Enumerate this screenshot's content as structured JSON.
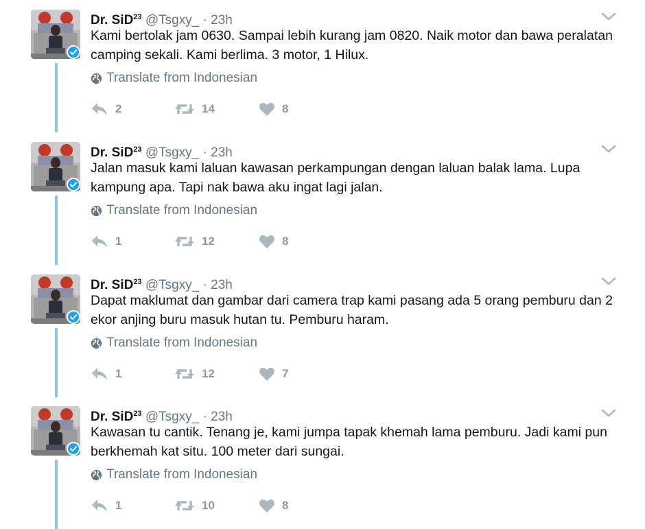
{
  "tweets": [
    {
      "name": "Dr. SiD",
      "name_sup": "23",
      "handle": "@Tsgxy_",
      "separator": "·",
      "time": "23h",
      "text": "Kami bertolak jam 0630. Sampai lebih kurang jam 0820. Naik motor dan bawa peralatan camping sekali. Kami berlima. 3 motor, 1 Hilux.",
      "translate": "Translate from Indonesian",
      "replies": "2",
      "retweets": "14",
      "likes": "8"
    },
    {
      "name": "Dr. SiD",
      "name_sup": "23",
      "handle": "@Tsgxy_",
      "separator": "·",
      "time": "23h",
      "text": "Jalan masuk kami laluan kawasan perkampungan dengan laluan balak lama. Lupa kampung apa. Tapi nak bawa aku ingat lagi jalan.",
      "translate": "Translate from Indonesian",
      "replies": "1",
      "retweets": "12",
      "likes": "8"
    },
    {
      "name": "Dr. SiD",
      "name_sup": "23",
      "handle": "@Tsgxy_",
      "separator": "·",
      "time": "23h",
      "text": "Dapat maklumat dan gambar dari camera trap kami pasang ada 5 orang pemburu dan 2 ekor anjing buru masuk hutan tu. Pemburu haram.",
      "translate": "Translate from Indonesian",
      "replies": "1",
      "retweets": "12",
      "likes": "7"
    },
    {
      "name": "Dr. SiD",
      "name_sup": "23",
      "handle": "@Tsgxy_",
      "separator": "·",
      "time": "23h",
      "text": "Kawasan tu cantik. Tenang je, kami jumpa tapak khemah lama pemburu. Jadi kami pun berkhemah kat situ. 100 meter dari sungai.",
      "translate": "Translate from Indonesian",
      "replies": "1",
      "retweets": "10",
      "likes": "8"
    }
  ],
  "icons": {
    "reply": "reply-icon",
    "retweet": "retweet-icon",
    "like": "heart-icon",
    "translate": "globe-icon",
    "caret": "chevron-down-icon",
    "verified": "verified-badge-icon"
  },
  "colors": {
    "text": "#14171a",
    "secondary": "#657786",
    "action_icon": "#aab8c2",
    "thread_line": "#8ec6de",
    "verified": "#1da1f2"
  }
}
